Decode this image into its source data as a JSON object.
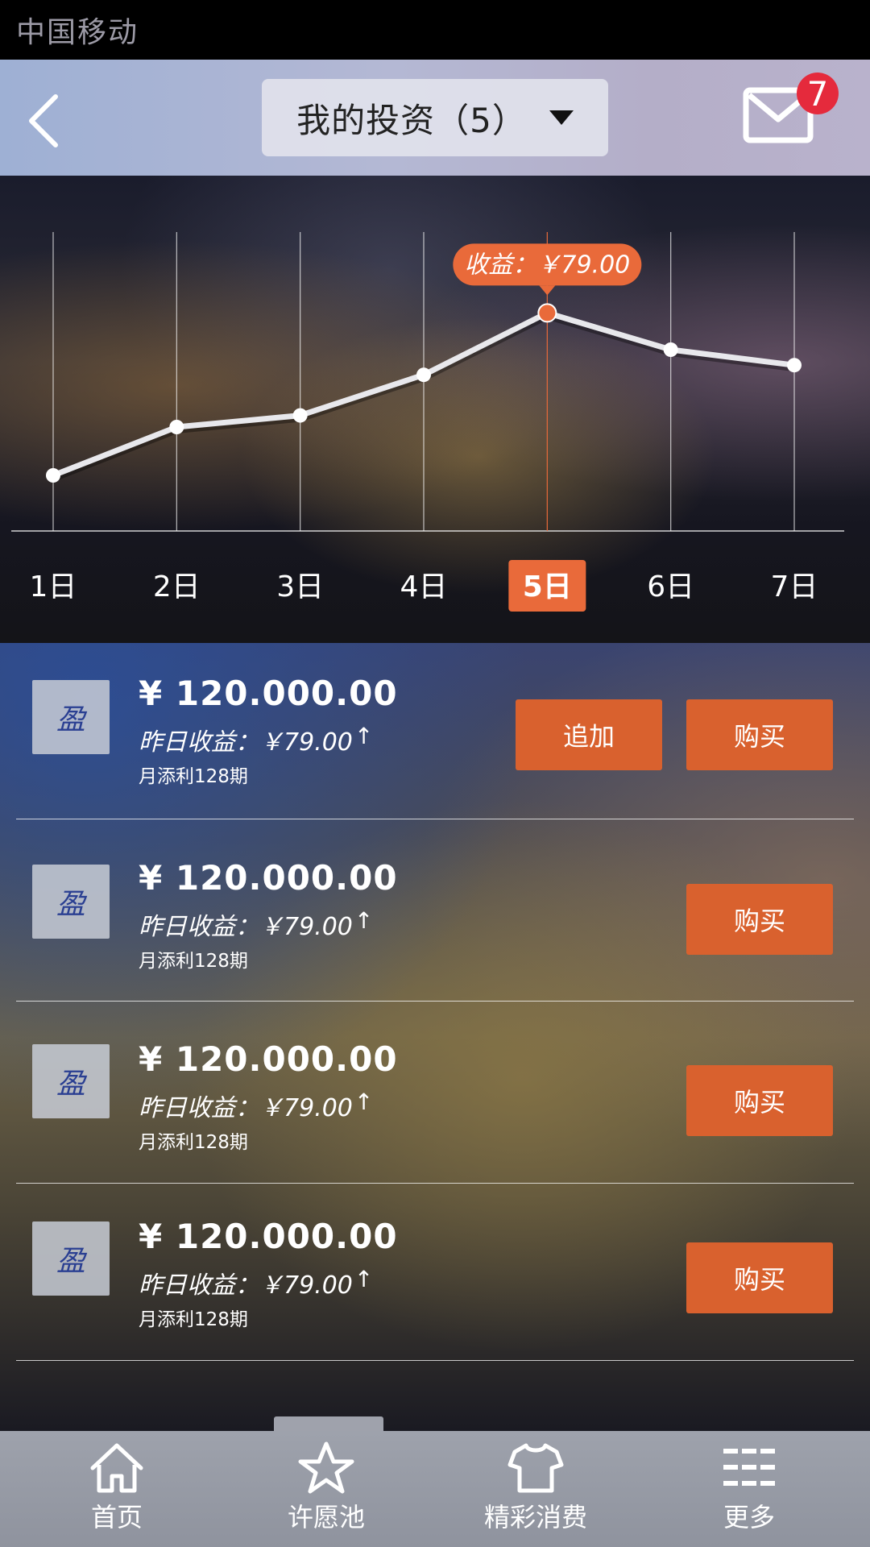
{
  "status_bar": {
    "carrier": "中国移动"
  },
  "header": {
    "title": "我的投资（5）",
    "unread_count": "7"
  },
  "chart_data": {
    "type": "line",
    "categories": [
      "1日",
      "2日",
      "3日",
      "4日",
      "5日",
      "6日",
      "7日"
    ],
    "values": [
      20,
      45,
      51,
      72,
      104,
      85,
      77
    ],
    "selected_index": 4,
    "tooltip": "收益：￥79.00",
    "grid": true,
    "colors": {
      "line": "#e8e8ec",
      "accent": "#e96a3a"
    }
  },
  "investments": [
    {
      "amount": "¥ 120.000.00",
      "yield": "昨日收益：￥79.00",
      "plan": "月添利128期",
      "logo_glyph": "盈",
      "extra_button": "追加",
      "buy_button": "购买"
    },
    {
      "amount": "¥ 120.000.00",
      "yield": "昨日收益：￥79.00",
      "plan": "月添利128期",
      "logo_glyph": "盈",
      "buy_button": "购买"
    },
    {
      "amount": "¥ 120.000.00",
      "yield": "昨日收益：￥79.00",
      "plan": "月添利128期",
      "logo_glyph": "盈",
      "buy_button": "购买"
    },
    {
      "amount": "¥ 120.000.00",
      "yield": "昨日收益：￥79.00",
      "plan": "月添利128期",
      "logo_glyph": "盈",
      "buy_button": "购买"
    }
  ],
  "tab_bar": {
    "items": [
      {
        "label": "首页",
        "icon": "home-icon"
      },
      {
        "label": "许愿池",
        "icon": "star-icon"
      },
      {
        "label": "精彩消费",
        "icon": "tshirt-icon"
      },
      {
        "label": "更多",
        "icon": "menu-icon"
      }
    ],
    "active_index": 1
  }
}
